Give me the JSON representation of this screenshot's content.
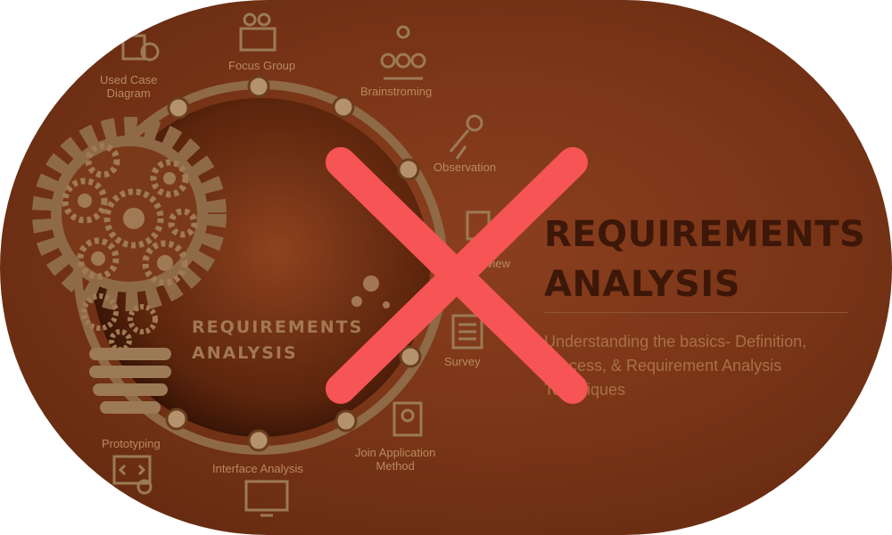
{
  "thumbnail": {
    "bulb_text_line1": "REQUIREMENTS",
    "bulb_text_line2": "ANALYSIS",
    "title_line1": "REQUIREMENTS",
    "title_line2": "ANALYSIS",
    "subtitle": "Understanding the basics- Definition, Process, & Requirement Analysis Techniques",
    "techniques": {
      "used_case_line1": "Used Case",
      "used_case_line2": "Diagram",
      "focus_group": "Focus Group",
      "brainstorming": "Brainstroming",
      "observation": "Observation",
      "interview": "Interview",
      "survey": "Survey",
      "jam_line1": "Join Application",
      "jam_line2": "Method",
      "interface_analysis": "Interface Analysis",
      "prototyping": "Prototyping"
    }
  },
  "overlay": {
    "icon": "close-x-icon",
    "color": "#f75455"
  },
  "colors": {
    "background": "#7a3517",
    "accent_text": "#b98a5e",
    "title": "#3d1708"
  }
}
